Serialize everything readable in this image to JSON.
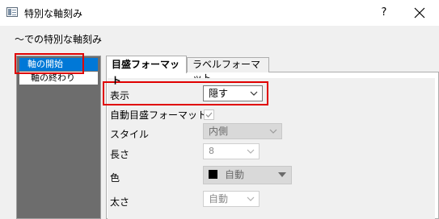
{
  "window": {
    "title": "特別な軸刻み",
    "help_label": "?"
  },
  "subheading": "〜での特別な軸刻み",
  "sidebar": {
    "items": [
      {
        "label": "軸の開始",
        "selected": true
      },
      {
        "label": "軸の終わり",
        "selected": false
      }
    ]
  },
  "tabs": [
    {
      "label": "目盛フォーマット",
      "active": true
    },
    {
      "label": "ラベルフォーマット",
      "active": false
    }
  ],
  "form": {
    "display": {
      "label": "表示",
      "value": "隠す"
    },
    "auto_tick_format": {
      "label": "自動目盛フォーマット",
      "checked": true
    },
    "style": {
      "label": "スタイル",
      "value": "内側"
    },
    "length": {
      "label": "長さ",
      "value": "8"
    },
    "color": {
      "label": "色",
      "value": "自動",
      "swatch": "#000000"
    },
    "thickness": {
      "label": "太さ",
      "value": "自動"
    }
  },
  "colors": {
    "selection": "#0078d7",
    "highlight": "#e00000"
  }
}
